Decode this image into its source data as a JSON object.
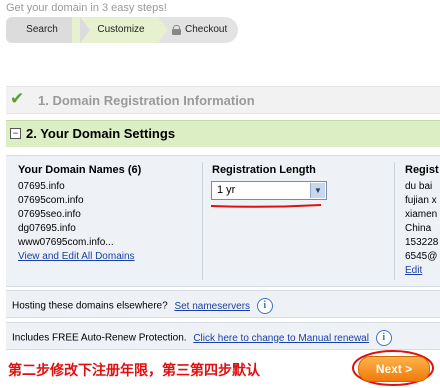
{
  "header": {
    "tagline": "Get your domain in 3 easy steps!",
    "steps": [
      {
        "label": "Search"
      },
      {
        "label": "Customize"
      },
      {
        "label": "Checkout",
        "icon": "lock-icon"
      }
    ]
  },
  "section1": {
    "title": "1. Domain Registration Information",
    "icon": "checkmark-icon"
  },
  "section2": {
    "title": "2. Your Domain Settings",
    "toggle": "⊟"
  },
  "domains": {
    "header": "Your Domain Names (6)",
    "items": [
      "07695.info",
      "07695com.info",
      "07695seo.info",
      "dg07695.info",
      "www07695com.info..."
    ],
    "view_link": "View and Edit All Domains"
  },
  "registration": {
    "header": "Registration Length",
    "selected": "1 yr"
  },
  "registrant": {
    "header": "Regist",
    "lines": [
      "du bai",
      "fujian x",
      "xiamen",
      "China",
      "153228",
      "6545@"
    ],
    "edit_link": "Edit"
  },
  "hosting": {
    "text": "Hosting these domains elsewhere?",
    "link": "Set nameservers"
  },
  "autorenew": {
    "text": "Includes FREE Auto-Renew Protection.",
    "link": "Click here to change to Manual renewal"
  },
  "annotation": "第二步修改下注册年限，第三第四步默认",
  "next_button": "Next >",
  "colors": {
    "accent_orange": "#f07a0a",
    "annotation_red": "#e01010",
    "section_green": "#dcefc4",
    "link_blue": "#1a3fa8"
  }
}
